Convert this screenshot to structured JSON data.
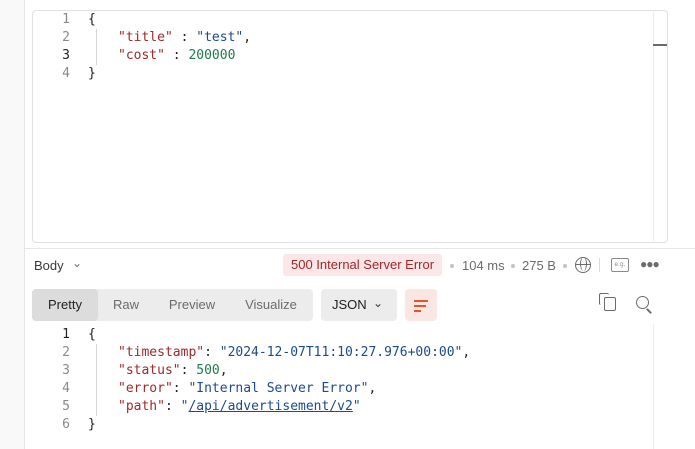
{
  "request_body": {
    "line_numbers": [
      "1",
      "2",
      "3",
      "4"
    ],
    "lines": [
      {
        "parts": [
          {
            "t": "{",
            "c": "p"
          }
        ]
      },
      {
        "parts": [
          {
            "t": "\"title\"",
            "c": "k"
          },
          {
            "t": " : ",
            "c": "p"
          },
          {
            "t": "\"test\"",
            "c": "s"
          },
          {
            "t": ",",
            "c": "p"
          }
        ]
      },
      {
        "parts": [
          {
            "t": "\"cost\"",
            "c": "k"
          },
          {
            "t": " : ",
            "c": "p"
          },
          {
            "t": "200000",
            "c": "n"
          }
        ]
      },
      {
        "parts": [
          {
            "t": "}",
            "c": "p"
          }
        ]
      }
    ]
  },
  "response_header": {
    "body_label": "Body",
    "status": "500 Internal Server Error",
    "status_color": "#a3262a",
    "status_bg": "#fbe7e7",
    "time": "104 ms",
    "size": "275 B",
    "icons": [
      "globe-icon",
      "save-response-example-icon",
      "more-options-icon"
    ]
  },
  "response_tabs": {
    "tabs": [
      "Pretty",
      "Raw",
      "Preview",
      "Visualize"
    ],
    "selected": "Pretty",
    "format": "JSON",
    "icons": [
      "wrap-lines-icon",
      "copy-icon",
      "search-icon"
    ]
  },
  "response_body": {
    "line_numbers": [
      "1",
      "2",
      "3",
      "4",
      "5",
      "6"
    ],
    "lines": [
      {
        "parts": [
          {
            "t": "{",
            "c": "p"
          }
        ]
      },
      {
        "parts": [
          {
            "t": "\"timestamp\"",
            "c": "k"
          },
          {
            "t": ": ",
            "c": "p"
          },
          {
            "t": "\"2024-12-07T11:10:27.976+00:00\"",
            "c": "s"
          },
          {
            "t": ",",
            "c": "p"
          }
        ]
      },
      {
        "parts": [
          {
            "t": "\"status\"",
            "c": "k"
          },
          {
            "t": ": ",
            "c": "p"
          },
          {
            "t": "500",
            "c": "n"
          },
          {
            "t": ",",
            "c": "p"
          }
        ]
      },
      {
        "parts": [
          {
            "t": "\"error\"",
            "c": "k"
          },
          {
            "t": ": ",
            "c": "p"
          },
          {
            "t": "\"Internal Server Error\"",
            "c": "s"
          },
          {
            "t": ",",
            "c": "p"
          }
        ]
      },
      {
        "parts": [
          {
            "t": "\"path\"",
            "c": "k"
          },
          {
            "t": ": ",
            "c": "p"
          },
          {
            "t": "\"",
            "c": "s"
          },
          {
            "t": "/api/advertisement/v2",
            "c": "link"
          },
          {
            "t": "\"",
            "c": "s"
          }
        ]
      },
      {
        "parts": [
          {
            "t": "}",
            "c": "p"
          }
        ]
      }
    ]
  }
}
